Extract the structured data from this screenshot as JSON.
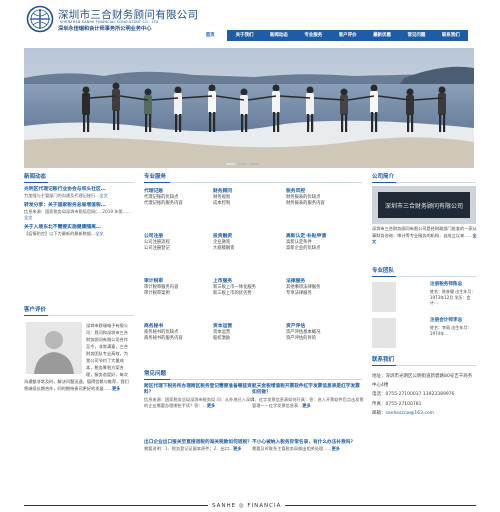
{
  "header": {
    "logo_cn": "深圳市三合财务顾问有限公司",
    "logo_en": "SHENZHEN SANHE FINANCIAL CONSULTANT CO., LTD.",
    "subtitle": "深圳永佳瑞和会计师事务所公明业务中心"
  },
  "nav": [
    "首页",
    "关于我们",
    "新闻动态",
    "专业服务",
    "客户评价",
    "最新优惠",
    "常见问题",
    "联系我们"
  ],
  "colors": {
    "brand": "#1e5da3",
    "nav_bg": "#1e5da3"
  },
  "news": {
    "title": "新闻动态",
    "items": [
      {
        "title": "光明区代理记账行业协会与坝头社区…",
        "desc": "为加强与主管部门的沟通及代理记账行…",
        "more": "全文"
      },
      {
        "title": "转发分享：关于国家税务总局增值税…",
        "desc": "信息来源：国家税务局深圳市税局官网(…",
        "date": "2019 年第……",
        "more": "全文"
      },
      {
        "title": "关于入境东北不需要实施健康隔离…",
        "desc": "【疫情防控】以下为最新的最新数据…",
        "more": "全文"
      }
    ]
  },
  "services": {
    "title": "专业服务",
    "cols": [
      {
        "title": "代理记账",
        "items": [
          "代理记账的优缺点",
          "代理记账的服务内容"
        ]
      },
      {
        "title": "财务顾问",
        "items": [
          "财务规划",
          "成本控制"
        ]
      },
      {
        "title": "税务风控",
        "items": [
          "财务报表的优缺点",
          "财务报表的服务内容"
        ]
      },
      {
        "title": "公司注册",
        "items": [
          "公司注册流程",
          "公司注册登记"
        ]
      },
      {
        "title": "投资融资",
        "items": [
          "企业融资",
          "大规模融资"
        ]
      },
      {
        "title": "高新认定·补贴申请",
        "items": [
          "高新认定条件",
          "高新企业的优缺点"
        ]
      },
      {
        "title": "审计税审",
        "items": [
          "审计税审服务内容",
          "审计税审案例"
        ]
      },
      {
        "title": "上市服务",
        "items": [
          "新三板上市一体化服务",
          "新三板上市的优劣势"
        ]
      },
      {
        "title": "法律服务",
        "items": [
          "其他事项法律服务",
          "专项法律服务"
        ]
      },
      {
        "title": "商务秘书",
        "items": [
          "商务秘书的优缺点",
          "商务秘书的服务内容"
        ]
      },
      {
        "title": "资本运营",
        "items": [
          "资本运营",
          "股权激励"
        ]
      },
      {
        "title": "资产评估",
        "items": [
          "资产评估基本概况",
          "资产评估的目的"
        ]
      }
    ]
  },
  "company": {
    "title": "公司简介",
    "sign": "深圳市三合财务顾问有限公司",
    "desc": "深圳市三合财务顾问有限公司是经财政部门批准的一家从事财务咨询、审计等专业服务的机构，自成立以来……",
    "more": "全文"
  },
  "team": {
    "title": "专业团队",
    "members": [
      {
        "name": "注册税务师陈总",
        "desc": "姓名：陈彦健 出生年月：1973年12月 学历：会计…"
      },
      {
        "name": "注册会计师李总",
        "desc": "姓名：李丽 出生年月：1974年…"
      }
    ]
  },
  "evaluation": {
    "title": "客户评价",
    "text": "深圳市欧瑞电子有限公司：我司和深圳市三合财务顾问有限公司合作至今，非常满意，三合财务团队专业高效，为我公司节约了大量成本，税务筹划方案合理，服务态度好，每次沟通都非常及时，解决问题迅速，值得信赖与推荐，我们将继续长期合作，同时期待贵司更好的发展……",
    "more": "更多"
  },
  "faq": {
    "title": "常见问题",
    "items": [
      {
        "title": "跨区代理下税务所办理跨区税务登记需要准备哪些资料？",
        "desc": "信息来源：国家税务总局深圳市税务局 问：从外地迁入深圳的企业需要办理哪些手续？答：…",
        "more": "更多"
      },
      {
        "title": "航天金税增值税开票软件红字发票信息表是红字发票如何做？",
        "desc": "1、红字发票信息表如何开具：答：进入开票软件后点击发票管理——红字发票信息表…",
        "more": "更多"
      },
      {
        "title": "出口企业出口报关至直接退税的海关税款如何退税？",
        "desc": "需要说明：1、税务登记证副本原件；2、出口…",
        "more": "更多"
      },
      {
        "title": "不小心被纳入税务异常名录，有什么办法补救吗？",
        "desc": "需要及时联系主管税务局做出相关处理……",
        "more": "更多"
      }
    ]
  },
  "contact": {
    "title": "联系我们",
    "lines": [
      {
        "label": "地址：",
        "value": "深圳市光明区公明街道新碧路80号吉千商务中心4楼"
      },
      {
        "label": "电话：",
        "value": "0755-27100037 13923389976"
      },
      {
        "label": "传真：",
        "value": "0755-27100781"
      },
      {
        "label": "邮箱：",
        "value": "sanheszcw@163.com"
      }
    ]
  },
  "footer": {
    "logo": "SANHE ◎ FINANCIA"
  }
}
